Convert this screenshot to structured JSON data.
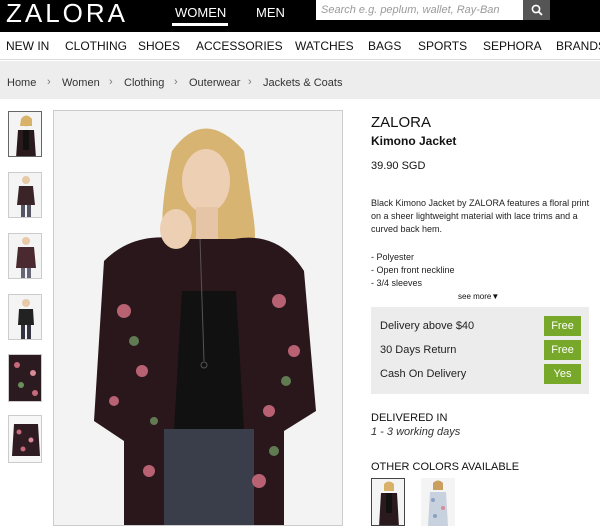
{
  "header": {
    "logo": "ZALORA",
    "gender_tabs": [
      "WOMEN",
      "MEN"
    ],
    "active_gender": "WOMEN",
    "search_placeholder": "Search e.g. peplum, wallet, Ray-Ban"
  },
  "categories": [
    "NEW IN",
    "CLOTHING",
    "SHOES",
    "ACCESSORIES",
    "WATCHES",
    "BAGS",
    "SPORTS",
    "SEPHORA",
    "BRANDS"
  ],
  "breadcrumb": [
    "Home",
    "Women",
    "Clothing",
    "Outerwear",
    "Jackets & Coats"
  ],
  "product": {
    "brand": "ZALORA",
    "name": "Kimono Jacket",
    "price": "39.90 SGD",
    "description": "Black Kimono Jacket by ZALORA features a floral print on a sheer lightweight material with lace trims and a curved back hem.",
    "bullets": [
      "- Polyester",
      "- Open front neckline",
      "- 3/4 sleeves"
    ],
    "see_more": "see more"
  },
  "services": [
    {
      "label": "Delivery above $40",
      "value": "Free"
    },
    {
      "label": "30 Days Return",
      "value": "Free"
    },
    {
      "label": "Cash On Delivery",
      "value": "Yes"
    }
  ],
  "delivery": {
    "title": "DELIVERED IN",
    "days": "1 - 3 working days"
  },
  "other_colors": {
    "title": "OTHER COLORS AVAILABLE"
  },
  "colors": {
    "accent_green": "#77a829",
    "topbar": "#000000",
    "breadcrumb_bg": "#ededed"
  }
}
